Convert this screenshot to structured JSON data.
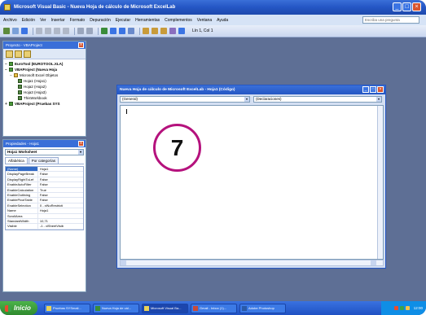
{
  "window": {
    "title": "Microsoft Visual Basic - Nueva Hoja de cálculo de Microsoft ExcelLab",
    "buttons": [
      "_",
      "□",
      "×"
    ]
  },
  "menu": {
    "items": [
      "Archivo",
      "Edición",
      "Ver",
      "Insertar",
      "Formato",
      "Depuración",
      "Ejecutar",
      "Herramientas",
      "Complementos",
      "Ventana",
      "Ayuda"
    ],
    "help_placeholder": "Escriba una pregunta"
  },
  "toolbar": {
    "position": "Lín 1, Col 1"
  },
  "project_panel": {
    "title": "Proyecto - VBAProject",
    "close": "x",
    "tree": [
      {
        "sym": "−",
        "label": "EuroTool (EUROTOOL.XLA)",
        "type": "project"
      },
      {
        "sym": "−",
        "label": "VBAProject (Nueva Hoja",
        "type": "project"
      },
      {
        "sym": "−",
        "label": "Microsoft Excel Objetos",
        "type": "folder"
      },
      {
        "sym": "",
        "label": "Hoja1 (Hoja1)",
        "type": "sheet"
      },
      {
        "sym": "",
        "label": "Hoja2 (Hoja2)",
        "type": "sheet"
      },
      {
        "sym": "",
        "label": "Hoja3 (Hoja3)",
        "type": "sheet"
      },
      {
        "sym": "",
        "label": "ThisWorkbook",
        "type": "sheet"
      },
      {
        "sym": "+",
        "label": "VBAProject (Pruebas SYS",
        "type": "project"
      }
    ]
  },
  "properties_panel": {
    "title": "Propiedades - Hoja1",
    "close": "x",
    "object": "Hoja1 Worksheet",
    "tabs": [
      "Alfabética",
      "Por categorías"
    ],
    "rows": [
      {
        "name": "(Name)",
        "value": "Hoja1",
        "selected": true
      },
      {
        "name": "DisplayPageBreak",
        "value": "False"
      },
      {
        "name": "DisplayRightToLef",
        "value": "False"
      },
      {
        "name": "EnableAutoFilter",
        "value": "False"
      },
      {
        "name": "EnableCalculation",
        "value": "True"
      },
      {
        "name": "EnableOutlining",
        "value": "False"
      },
      {
        "name": "EnablePivotTable",
        "value": "False"
      },
      {
        "name": "EnableSelection",
        "value": "0 - xlNoRestricti"
      },
      {
        "name": "Name",
        "value": "Hoja1"
      },
      {
        "name": "ScrollArea",
        "value": ""
      },
      {
        "name": "StandardWidth",
        "value": "10,71"
      },
      {
        "name": "Visible",
        "value": "-1 - xlSheetVisib"
      }
    ]
  },
  "code_window": {
    "title": "Nueva Hoja de cálculo de Microsoft ExcelLab - Hoja1 (Código)",
    "object_combo": "(General)",
    "proc_combo": "(Declaraciones)",
    "buttons": [
      "_",
      "□",
      "×"
    ]
  },
  "callout": {
    "number": "7"
  },
  "taskbar": {
    "start": "Inicio",
    "tasks": [
      "Pruebas SYSmail...",
      "Nueva Hoja de cál...",
      "Microsoft Visual Ba...",
      "Gmail - Inbox (1)...",
      "Adobe Photoshop"
    ],
    "clock": "12:00"
  }
}
